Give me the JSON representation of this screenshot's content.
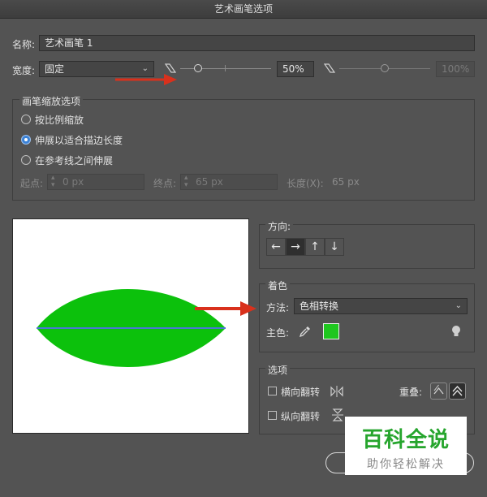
{
  "window": {
    "title": "艺术画笔选项"
  },
  "name_row": {
    "label": "名称:",
    "value": "艺术画笔 1"
  },
  "width_row": {
    "label": "宽度:",
    "select_value": "固定",
    "left_slider_percent": 20,
    "value": "50%",
    "right_slider_percent": 50,
    "right_value": "100%"
  },
  "scale_group": {
    "title": "画笔缩放选项",
    "options": [
      "按比例缩放",
      "伸展以适合描边长度",
      "在参考线之间伸展"
    ],
    "selected_index": 1,
    "start_label": "起点:",
    "start_value": "0 px",
    "end_label": "终点:",
    "end_value": "65 px",
    "length_label": "长度(X):",
    "length_value": "65 px"
  },
  "direction": {
    "title": "方向:",
    "buttons": [
      "←",
      "→",
      "↑",
      "↓"
    ],
    "selected_index": 1
  },
  "colorization": {
    "title": "着色",
    "method_label": "方法:",
    "method_value": "色相转换",
    "key_color_label": "主色:",
    "key_color": "#1fc71f",
    "tip_icon": "lightbulb-icon"
  },
  "options": {
    "title": "选项",
    "flip_horizontal": "横向翻转",
    "flip_vertical": "纵向翻转",
    "overlap_label": "重叠:"
  },
  "preview": {
    "leaf_color": "#0cc10c",
    "center_line_color": "#4a78d4"
  },
  "annotations": {
    "arrow_color": "#d9311c"
  },
  "watermark": {
    "title": "百科全说",
    "subtitle": "助你轻松解决"
  }
}
